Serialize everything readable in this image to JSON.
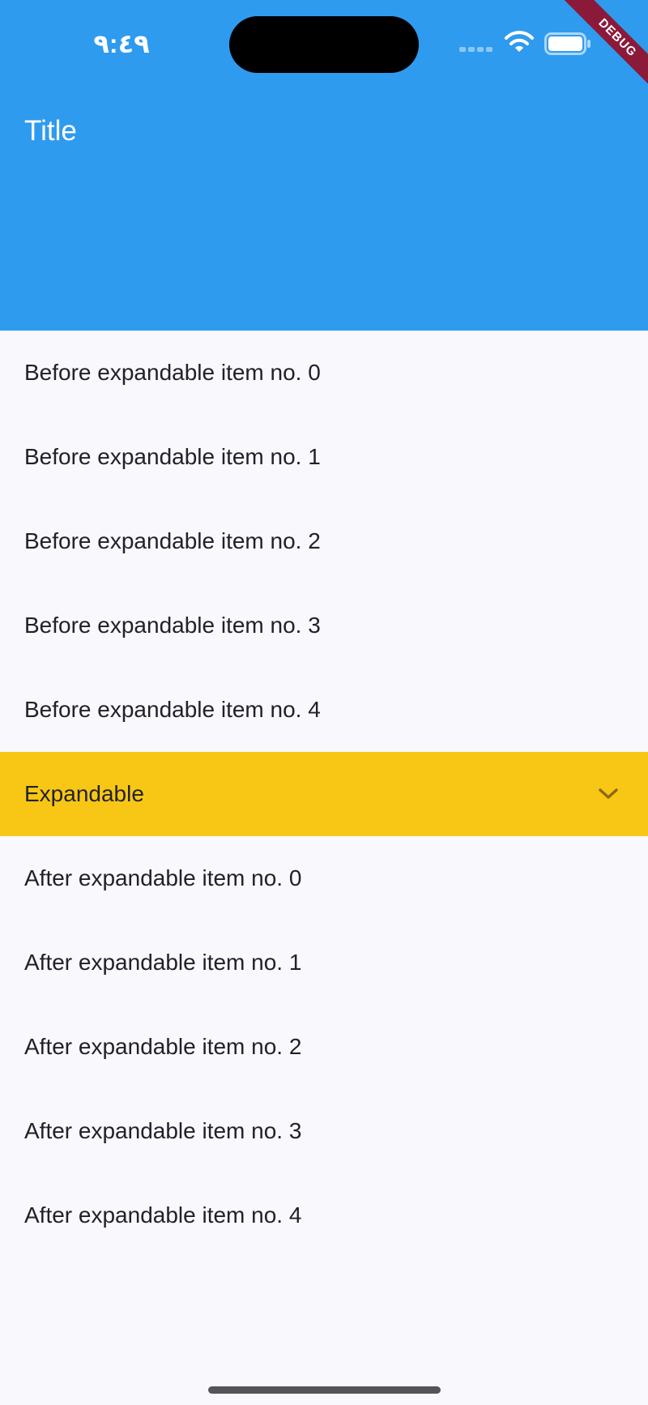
{
  "status_bar": {
    "time": "٩:٤٩"
  },
  "debug_banner": {
    "label": "DEBUG"
  },
  "app_bar": {
    "title": "Title",
    "color": "#2f9bee"
  },
  "list": {
    "before_items": [
      "Before expandable item no. 0",
      "Before expandable item no. 1",
      "Before expandable item no. 2",
      "Before expandable item no. 3",
      "Before expandable item no. 4"
    ],
    "expandable": {
      "label": "Expandable",
      "color": "#f8c715",
      "icon": "chevron-down-icon"
    },
    "after_items": [
      "After expandable item no. 0",
      "After expandable item no. 1",
      "After expandable item no. 2",
      "After expandable item no. 3",
      "After expandable item no. 4"
    ]
  }
}
